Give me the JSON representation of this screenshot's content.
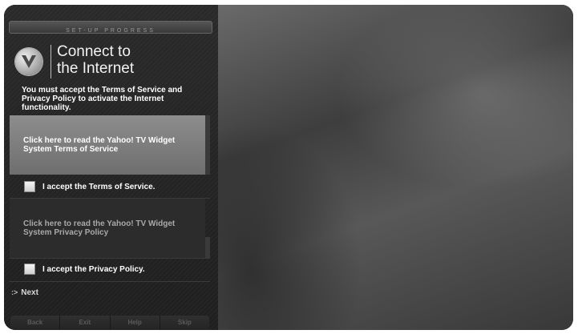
{
  "header": {
    "progress_label": "SET-UP PROGRESS",
    "title_line1": "Connect to",
    "title_line2": "the Internet"
  },
  "logo": {
    "icon": "vizio-v-logo-icon",
    "glyph": "V"
  },
  "notice": "You must accept the Terms of Service and Privacy Policy to activate the Internet functionality.",
  "terms": {
    "link_text": "Click here to read the Yahoo! TV Widget System Terms of Service",
    "accept_label": "I accept the Terms of Service."
  },
  "privacy": {
    "link_text": "Click here to read the Yahoo! TV Widget System Privacy Policy",
    "accept_label": "I accept the Privacy Policy."
  },
  "next": {
    "arrow": ":>",
    "label": "Next"
  },
  "bottom_bar": {
    "back": "Back",
    "exit": "Exit",
    "help": "Help",
    "skip": "Skip"
  }
}
